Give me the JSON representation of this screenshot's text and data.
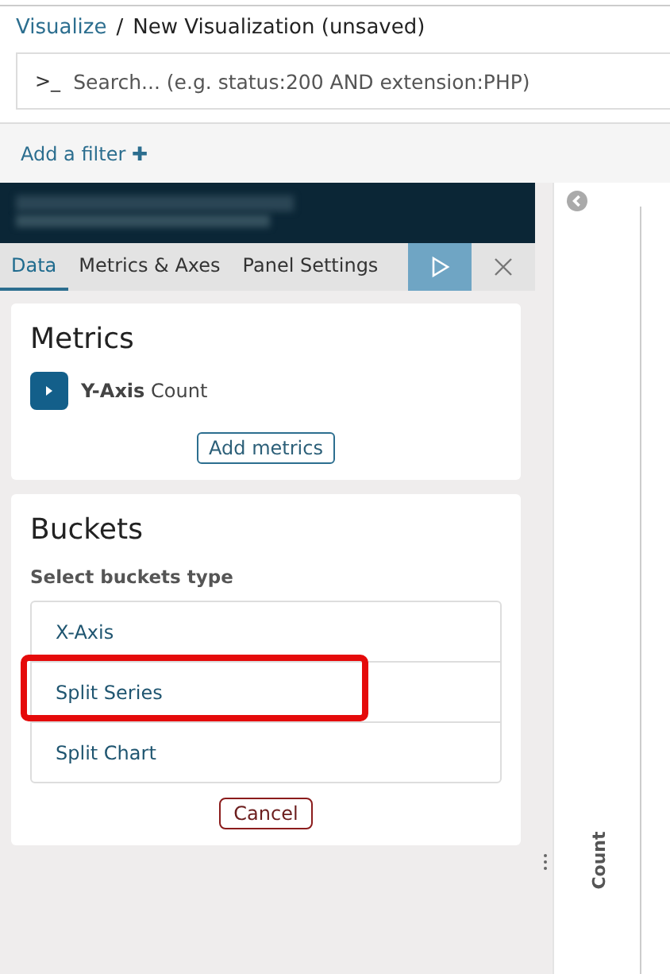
{
  "breadcrumb": {
    "parent": "Visualize",
    "separator": "/",
    "current": "New Visualization (unsaved)"
  },
  "search": {
    "prompt": ">_",
    "placeholder": "Search... (e.g. status:200 AND extension:PHP)"
  },
  "filter_bar": {
    "label": "Add a filter",
    "icon": "✚"
  },
  "tabs": [
    {
      "label": "Data",
      "selected": true
    },
    {
      "label": "Metrics & Axes",
      "selected": false
    },
    {
      "label": "Panel Settings",
      "selected": false
    }
  ],
  "metrics": {
    "title": "Metrics",
    "items": [
      {
        "name": "Y-Axis",
        "value": "Count",
        "expanded": false
      }
    ],
    "add_button": "Add metrics"
  },
  "buckets": {
    "title": "Buckets",
    "subtitle": "Select buckets type",
    "options": [
      {
        "label": "X-Axis",
        "highlighted": false
      },
      {
        "label": "Split Series",
        "highlighted": true
      },
      {
        "label": "Split Chart",
        "highlighted": false
      }
    ],
    "cancel_button": "Cancel"
  },
  "chart": {
    "axis_label": "Count"
  }
}
